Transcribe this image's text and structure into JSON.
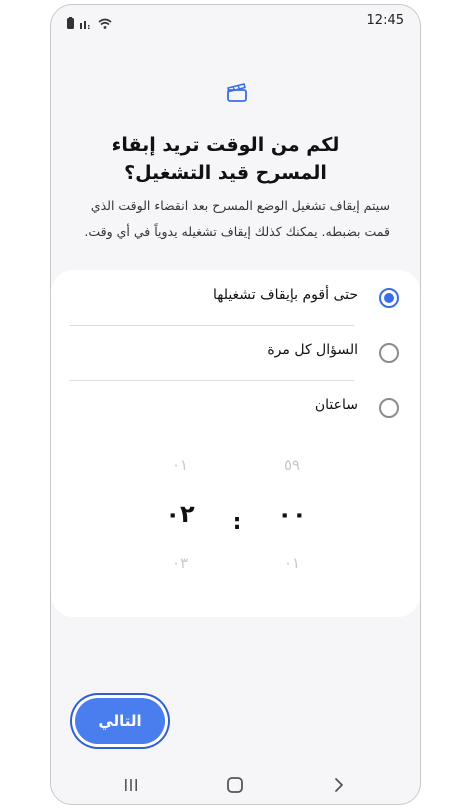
{
  "status_bar": {
    "time": "12:45"
  },
  "header": {
    "title": "لكم من الوقت تريد إبقاء المسرح قيد التشغيل؟",
    "description": "سيتم إيقاف تشغيل الوضع المسرح بعد انقضاء الوقت الذي قمت بضبطه. يمكنك كذلك إيقاف تشغيله يدوياً في أي وقت."
  },
  "options": [
    {
      "label": "حتى أقوم بإيقاف تشغيلها",
      "selected": true
    },
    {
      "label": "السؤال كل مرة",
      "selected": false
    },
    {
      "label": "ساعتان",
      "selected": false
    }
  ],
  "time_picker": {
    "hours": {
      "above": "٠١",
      "selected": "٠٢",
      "below": "٠٣"
    },
    "minutes": {
      "above": "٥٩",
      "selected": "٠٠",
      "below": "٠١"
    },
    "separator": ":"
  },
  "next_button": {
    "label": "التالي"
  },
  "colors": {
    "accent": "#3a6ee8",
    "button": "#4a7ded",
    "background": "#f6f6f8",
    "card": "#ffffff"
  },
  "icons": [
    "battery-icon",
    "signal-icon",
    "wifi-icon",
    "theater-mode-icon",
    "recent-apps-icon",
    "home-icon",
    "back-icon"
  ]
}
